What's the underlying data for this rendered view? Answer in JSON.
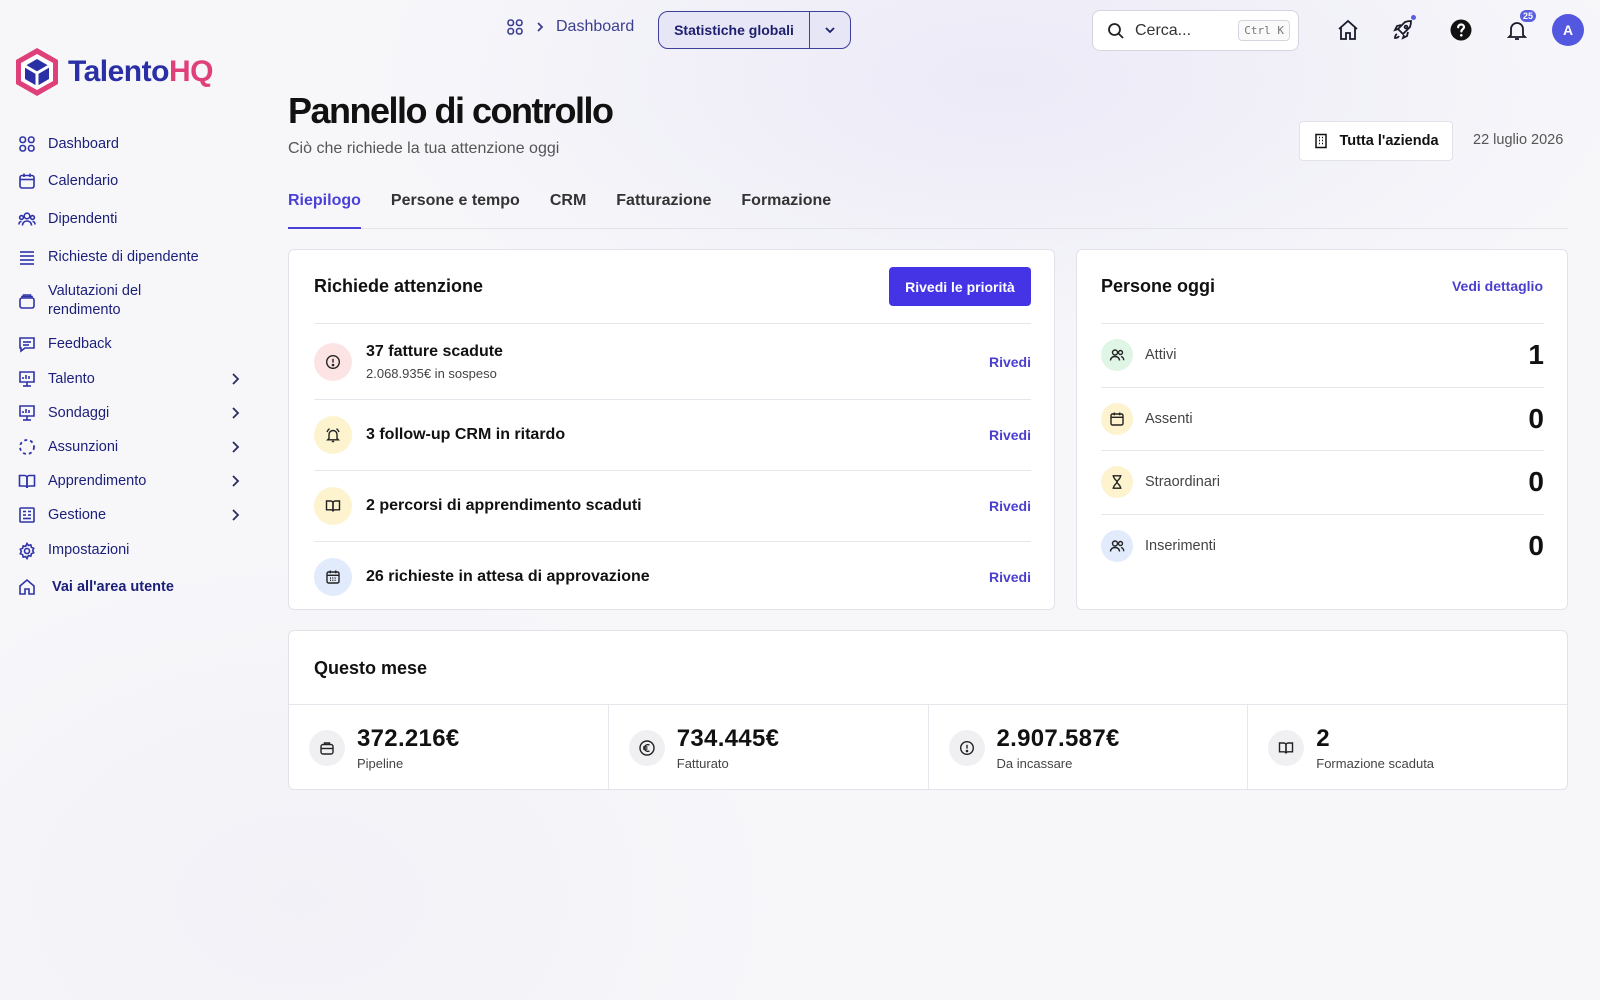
{
  "brand": {
    "name_part1": "Talento",
    "name_part2": "HQ",
    "color1": "#2b2fa6",
    "color2": "#e0407a"
  },
  "sidebar": {
    "items": [
      {
        "label": "Dashboard",
        "icon": "grid-icon"
      },
      {
        "label": "Calendario",
        "icon": "calendar-icon"
      },
      {
        "label": "Dipendenti",
        "icon": "users-icon"
      },
      {
        "label": "Richieste di dipendente",
        "icon": "list-icon"
      },
      {
        "label": "Valutazioni del rendimento",
        "icon": "folder-icon"
      },
      {
        "label": "Feedback",
        "icon": "message-icon"
      },
      {
        "label": "Talento",
        "icon": "chart-icon",
        "expandable": true
      },
      {
        "label": "Sondaggi",
        "icon": "chart-icon",
        "expandable": true
      },
      {
        "label": "Assunzioni",
        "icon": "dashed-circle-icon",
        "expandable": true
      },
      {
        "label": "Apprendimento",
        "icon": "book-icon",
        "expandable": true
      },
      {
        "label": "Gestione",
        "icon": "building-icon",
        "expandable": true
      },
      {
        "label": "Impostazioni",
        "icon": "gear-icon"
      },
      {
        "label": "Vai all'area utente",
        "icon": "home-icon"
      }
    ]
  },
  "header": {
    "breadcrumb": "Dashboard",
    "scope_label": "Statistiche globali",
    "search_placeholder": "Cerca...",
    "search_shortcut": "Ctrl K",
    "notification_count": "25",
    "avatar_initial": "A"
  },
  "page": {
    "title": "Pannello di controllo",
    "subtitle": "Ciò che richiede la tua attenzione oggi",
    "company_button": "Tutta l'azienda",
    "date": "22 luglio 2026"
  },
  "tabs": [
    {
      "label": "Riepilogo",
      "active": true
    },
    {
      "label": "Persone e tempo",
      "active": false
    },
    {
      "label": "CRM",
      "active": false
    },
    {
      "label": "Fatturazione",
      "active": false
    },
    {
      "label": "Formazione",
      "active": false
    }
  ],
  "attention": {
    "title": "Richiede attenzione",
    "button": "Rivedi le priorità",
    "action_label": "Rivedi",
    "items": [
      {
        "title": "37 fatture scadute",
        "subtitle": "2.068.935€ in sospeso",
        "icon": "alert-circle-icon",
        "bg": "#fde4e4"
      },
      {
        "title": "3 follow-up CRM in ritardo",
        "subtitle": "",
        "icon": "bell-icon",
        "bg": "#fdf3cf"
      },
      {
        "title": "2 percorsi di apprendimento scaduti",
        "subtitle": "",
        "icon": "book-icon",
        "bg": "#fdf3cf"
      },
      {
        "title": "26 richieste in attesa di approvazione",
        "subtitle": "",
        "icon": "calendar-icon",
        "bg": "#e1ebfb"
      }
    ]
  },
  "people": {
    "title": "Persone oggi",
    "detail_link": "Vedi dettaglio",
    "rows": [
      {
        "label": "Attivi",
        "value": "1",
        "icon": "users-icon",
        "bg": "#dff5e6"
      },
      {
        "label": "Assenti",
        "value": "0",
        "icon": "calendar-icon",
        "bg": "#fdf3cf"
      },
      {
        "label": "Straordinari",
        "value": "0",
        "icon": "hourglass-icon",
        "bg": "#fdf3cf"
      },
      {
        "label": "Inserimenti",
        "value": "0",
        "icon": "users-icon",
        "bg": "#e1ebfb"
      }
    ]
  },
  "month": {
    "title": "Questo mese",
    "stats": [
      {
        "value": "372.216€",
        "label": "Pipeline",
        "icon": "briefcase-icon"
      },
      {
        "value": "734.445€",
        "label": "Fatturato",
        "icon": "euro-icon"
      },
      {
        "value": "2.907.587€",
        "label": "Da incassare",
        "icon": "alert-circle-icon"
      },
      {
        "value": "2",
        "label": "Formazione scaduta",
        "icon": "book-icon"
      }
    ]
  }
}
